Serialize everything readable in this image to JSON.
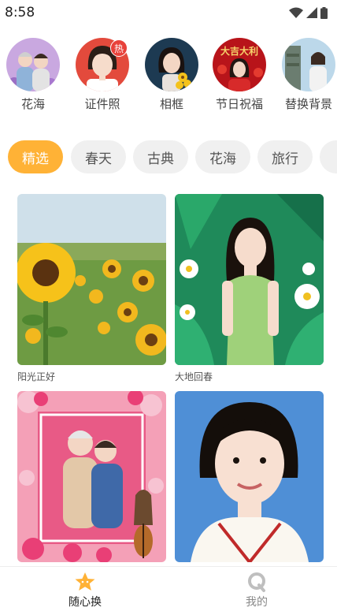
{
  "status_bar": {
    "time": "8:58",
    "icons": [
      "wifi-icon",
      "cell-signal-icon",
      "battery-icon"
    ]
  },
  "categories": [
    {
      "label": "花海",
      "hot": false
    },
    {
      "label": "证件照",
      "hot": true,
      "badge": "热"
    },
    {
      "label": "相框",
      "hot": false
    },
    {
      "label": "节日祝福",
      "hot": false,
      "image_text": "大吉大利"
    },
    {
      "label": "替换背景",
      "hot": false
    }
  ],
  "tabs": [
    {
      "label": "精选",
      "active": true
    },
    {
      "label": "春天",
      "active": false
    },
    {
      "label": "古典",
      "active": false
    },
    {
      "label": "花海",
      "active": false
    },
    {
      "label": "旅行",
      "active": false
    }
  ],
  "cards": [
    {
      "caption": "阳光正好",
      "theme": "sunflower"
    },
    {
      "caption": "大地回春",
      "theme": "green-leaves"
    },
    {
      "caption": "",
      "theme": "pink-rose-frame"
    },
    {
      "caption": "",
      "theme": "id-photo-blue"
    }
  ],
  "bottom_nav": [
    {
      "label": "随心换",
      "icon": "star-icon",
      "active": true
    },
    {
      "label": "我的",
      "icon": "profile-q-icon",
      "active": false
    }
  ],
  "colors": {
    "accent": "#ffb236",
    "tab_bg": "#f0f0f0",
    "hot_badge": "#e8413a",
    "active_nav_text": "#222222",
    "inactive_nav_text": "#888888"
  }
}
